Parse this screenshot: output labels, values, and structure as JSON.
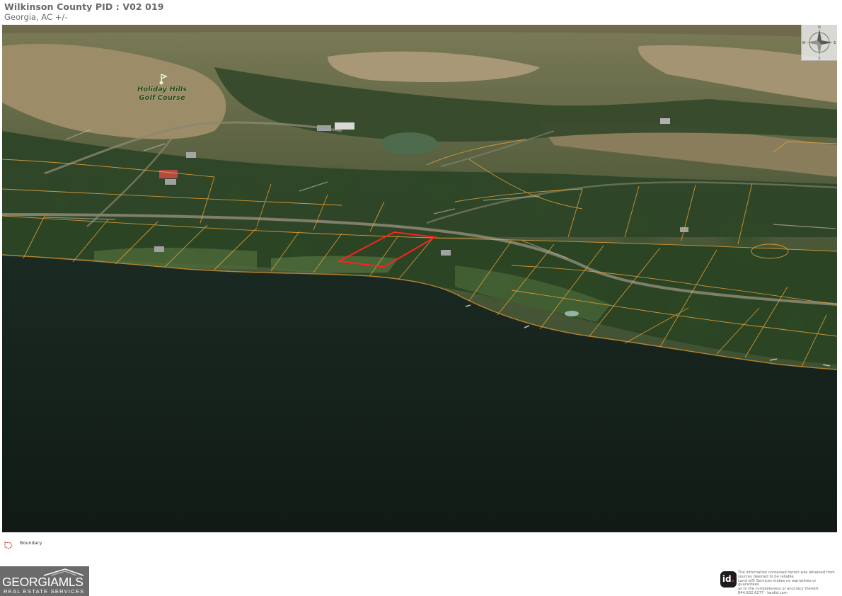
{
  "header": {
    "title": "Wilkinson County PID : V02 019",
    "subtitle": "Georgia,  AC +/-"
  },
  "map": {
    "type": "aerial-3d-parcel-view",
    "poi_label_line1": "Holiday Hills",
    "poi_label_line2": "Golf Course",
    "subject_parcel_color": "#ff2020",
    "parcel_line_color": "#e8a33a",
    "water_color": "#14211a",
    "compass": {
      "n": "N",
      "s": "S",
      "e": "E",
      "w": "W"
    }
  },
  "legend": {
    "items": [
      {
        "label": "Boundary",
        "icon": "boundary-polygon-icon",
        "color": "#e02020"
      }
    ]
  },
  "footer": {
    "gmls_main": "GEORGIAMLS",
    "gmls_sub": "REAL ESTATE SERVICES",
    "lid_logo": "id",
    "disclaimer_lines": [
      "The information contained herein was obtained from",
      "sources deemed to be reliable.",
      "Land id® Services makes no warranties or guarantees",
      "as to the completeness or accuracy thereof.",
      "844.932.6277 · landid.com"
    ]
  }
}
